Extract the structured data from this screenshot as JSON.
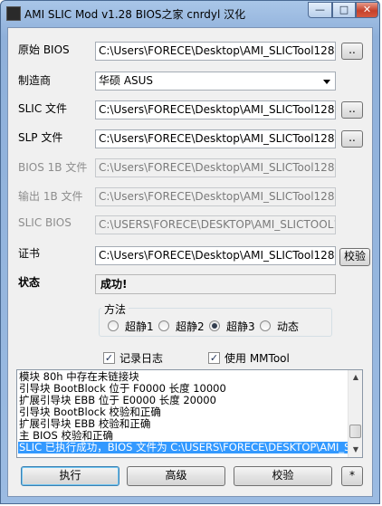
{
  "window": {
    "title": "AMI SLIC Mod v1.28  BIOS之家 cnrdyl 汉化",
    "minimize_glyph": "—",
    "maximize_glyph": "□",
    "close_glyph": "✕"
  },
  "fields": {
    "original_bios": {
      "label": "原始 BIOS",
      "value": "C:\\Users\\FORECE\\Desktop\\AMI_SLICTool128cn\\P5("
    },
    "manufacturer": {
      "label": "制造商",
      "value": "华硕 ASUS"
    },
    "slic_file": {
      "label": "SLIC 文件",
      "value": "C:\\Users\\FORECE\\Desktop\\AMI_SLICTool128cn\\SLI"
    },
    "slp_file": {
      "label": "SLP 文件",
      "value": "C:\\Users\\FORECE\\Desktop\\AMI_SLICTool128cn\\SLI"
    },
    "bios_1b_file": {
      "label": "BIOS 1B 文件",
      "value": "C:\\Users\\FORECE\\Desktop\\AMI_SLICTool128cn\\1B."
    },
    "output_1b_file": {
      "label": "输出 1B 文件",
      "value": "C:\\Users\\FORECE\\Desktop\\AMI_SLICTool128cn\\1B."
    },
    "slic_bios": {
      "label": "SLIC BIOS",
      "value": "C:\\USERS\\FORECE\\DESKTOP\\AMI_SLICTOOL128C"
    },
    "certificate": {
      "label": "证书",
      "value": "C:\\Users\\FORECE\\Desktop\\AMI_SLICTool128cn\\CE"
    },
    "status": {
      "label": "状态",
      "value": "成功!"
    }
  },
  "browse_label": "..",
  "verify_cert_label": "校验",
  "method": {
    "title": "方法",
    "options": [
      "超静1",
      "超静2",
      "超静3",
      "动态"
    ],
    "selected": "超静3"
  },
  "checkboxes": {
    "log": {
      "label": "记录日志",
      "checked": true
    },
    "mmtool": {
      "label": "使用 MMTool",
      "checked": true
    }
  },
  "check_glyph": "✓",
  "log_lines": [
    "模块 80h 中存在未链接块",
    "引导块 BootBlock 位于 F0000 长度 10000",
    "扩展引导块 EBB 位于 E0000 长度 20000",
    "引导块 BootBlock 校验和正确",
    "扩展引导块 EBB 校验和正确",
    "主 BIOS 校验和正确",
    "SLIC 已执行成功，BIOS 文件为 C:\\USERS\\FORECE\\DESKTOP\\AMI_SLI"
  ],
  "scroll_up_glyph": "▲",
  "scroll_down_glyph": "▼",
  "buttons": {
    "execute": "执行",
    "advanced": "高级",
    "verify": "校验",
    "extra": "*"
  }
}
